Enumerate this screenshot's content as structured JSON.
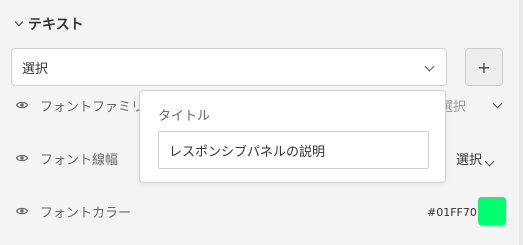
{
  "section": {
    "title": "テキスト"
  },
  "main_select": {
    "value": "選択"
  },
  "add_button": {
    "label": "+"
  },
  "rows": [
    {
      "label": "フォントファミリ",
      "select_value": "選択"
    },
    {
      "label": "フォント線幅",
      "select_value": "選択"
    },
    {
      "label": "フォントカラー",
      "color_value": "#01FF70"
    }
  ],
  "popover": {
    "title": "タイトル",
    "input_value": "レスポンシブパネルの説明"
  },
  "colors": {
    "swatch": "#01FF70"
  }
}
